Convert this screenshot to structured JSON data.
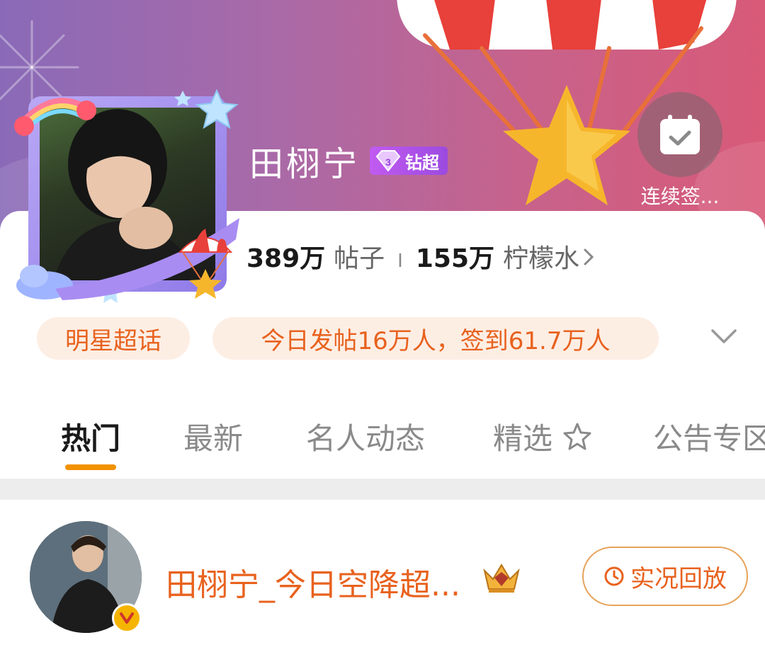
{
  "header": {
    "title": "田栩宁",
    "level_badge": "钻超",
    "level_number": "3",
    "streak_label": "连续签..."
  },
  "stats": {
    "posts_count": "389万",
    "posts_label": "帖子",
    "separator": "I",
    "fans_count": "155万",
    "fans_label": "柠檬水"
  },
  "tags": {
    "category": "明星超话",
    "activity": "今日发帖16万人，签到61.7万人"
  },
  "tabs": [
    {
      "label": "热门"
    },
    {
      "label": "最新"
    },
    {
      "label": "名人动态"
    },
    {
      "label": "精选"
    },
    {
      "label": "公告专区"
    }
  ],
  "active_tab": "热门",
  "post": {
    "title": "田栩宁_今日空降超...",
    "replay_label": "实况回放"
  },
  "colors": {
    "accent": "#e8621e",
    "tab_indicator": "#f29200",
    "tag_bg": "#fdeee4",
    "badge_purple": "#b35cf0"
  },
  "icons": [
    "calendar-check-icon",
    "diamond-icon",
    "chevron-right-icon",
    "chevron-down-icon",
    "star-sparkle-icon",
    "crown-icon",
    "clock-icon",
    "verified-v-icon"
  ]
}
